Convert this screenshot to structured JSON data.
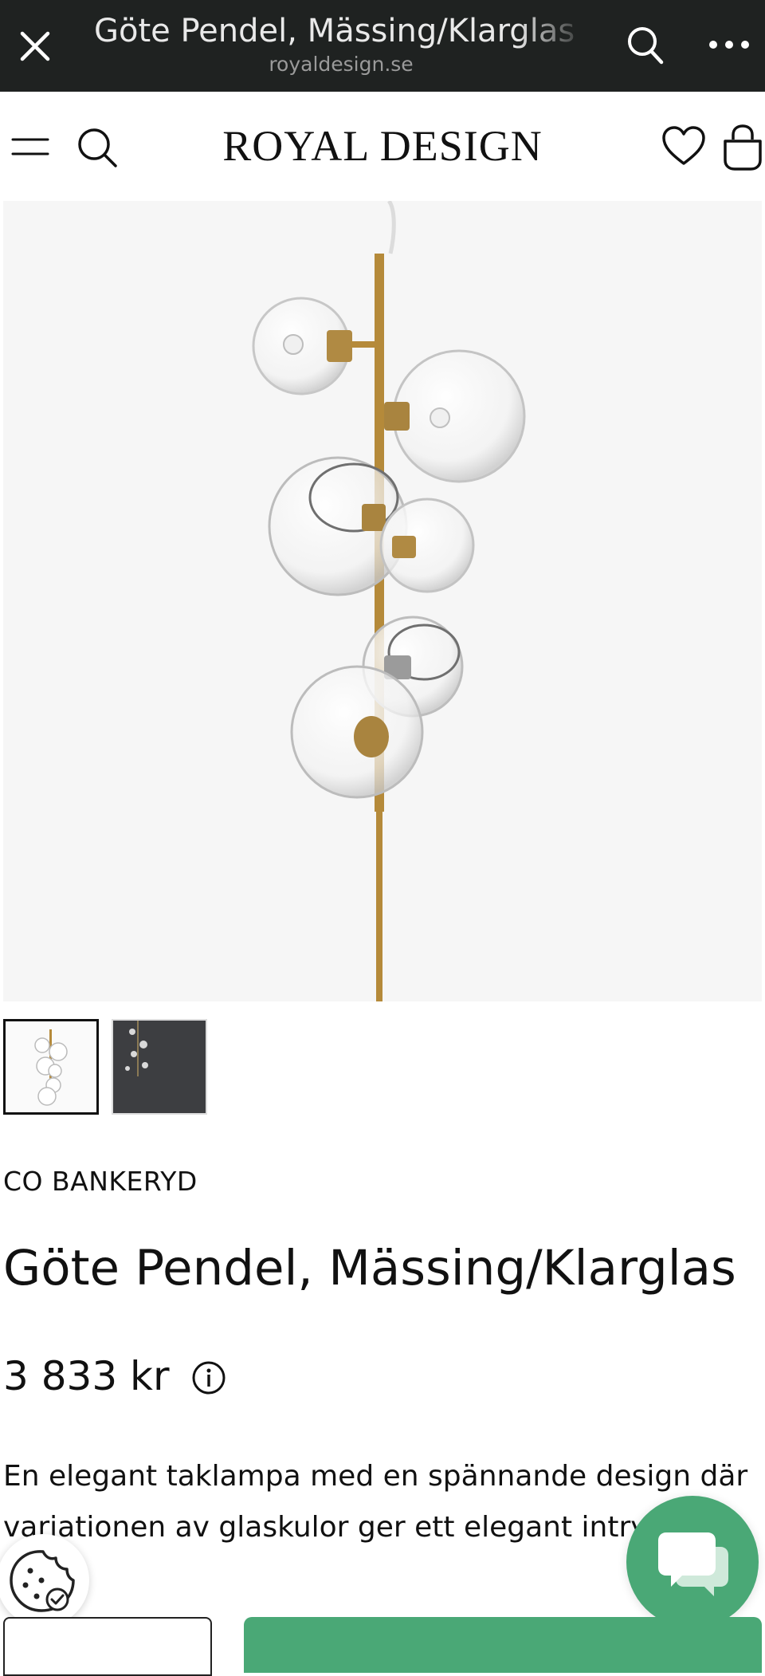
{
  "browser": {
    "title": "Göte Pendel, Mässing/Klarglas",
    "domain": "royaldesign.se"
  },
  "header": {
    "logo": "ROYAL DESIGN"
  },
  "product": {
    "brand": "CO BANKERYD",
    "title": "Göte Pendel, Mässing/Klarglas",
    "price": "3 833 kr",
    "description_lines": [
      "En elegant taklampa med en spännande design där",
      "variationen av glaskulor ger ett elegant intry"
    ]
  },
  "icons": {
    "close": "close-icon",
    "search": "search-icon",
    "more": "more-icon",
    "menu": "menu-icon",
    "wishlist": "heart-icon",
    "cart": "bag-icon",
    "info": "info-icon",
    "cookie": "cookie-icon",
    "chat": "chat-icon"
  },
  "colors": {
    "browser_bar": "#1f2221",
    "accent_green": "#4aa876",
    "image_bg": "#f6f6f6",
    "brass": "#b58a3a"
  }
}
